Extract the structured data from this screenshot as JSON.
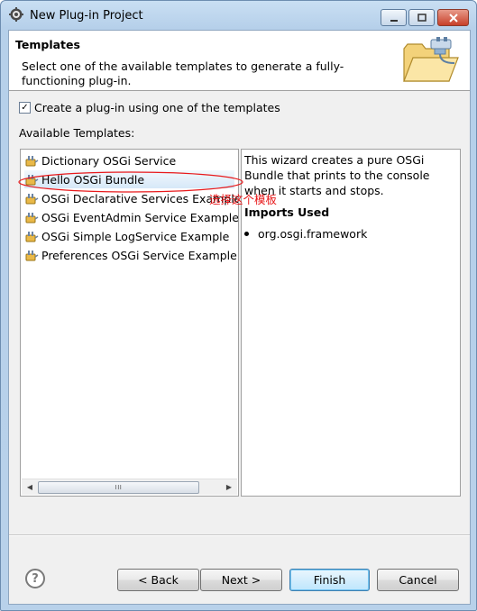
{
  "window": {
    "title": "New Plug-in Project"
  },
  "header": {
    "title": "Templates",
    "description": "Select one of the available templates to generate a fully-functioning plug-in."
  },
  "options": {
    "use_template_label": "Create a plug-in using one of the templates",
    "use_template_checked": true,
    "checkbox_glyph": "✓"
  },
  "templates": {
    "label": "Available Templates:",
    "items": [
      {
        "label": "Dictionary OSGi Service"
      },
      {
        "label": "Hello OSGi Bundle"
      },
      {
        "label": "OSGi Declarative Services Example"
      },
      {
        "label": "OSGi EventAdmin Service Example"
      },
      {
        "label": "OSGi Simple LogService Example"
      },
      {
        "label": "Preferences OSGi Service Example"
      }
    ],
    "selected_index": 1,
    "scroll_left": "◀",
    "scroll_right": "▶",
    "scroll_thumb": "III"
  },
  "details": {
    "description": "This wizard creates a pure OSGi Bundle that prints to the console when it starts and stops.",
    "imports_title": "Imports Used",
    "imports": [
      "org.osgi.framework"
    ]
  },
  "annotation": {
    "text": "选择这个模板",
    "color": "#e8191b"
  },
  "buttons": {
    "help": "?",
    "back": "< Back",
    "next": "Next >",
    "finish": "Finish",
    "cancel": "Cancel"
  },
  "icons": {
    "app": "eclipse-gear-icon",
    "header": "open-folder-plug-icon",
    "template_item": "plugin-icon",
    "help": "help-icon"
  }
}
